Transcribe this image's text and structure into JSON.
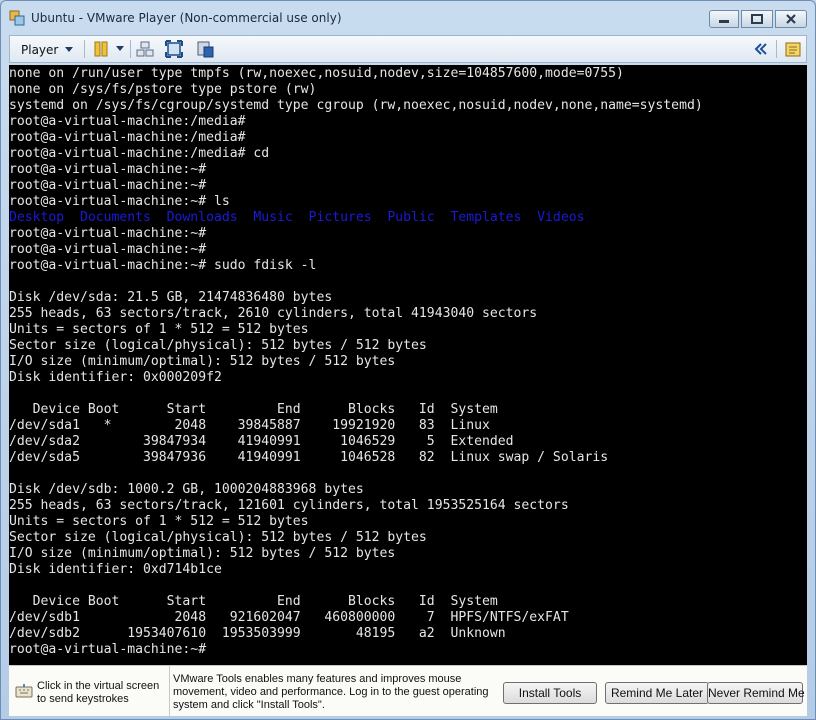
{
  "window": {
    "title": "Ubuntu - VMware Player (Non-commercial use only)"
  },
  "toolbar": {
    "player_label": "Player",
    "icons": [
      "pause-icon",
      "send-keys-icon",
      "fullscreen-icon",
      "unity-icon",
      "collapse-icon",
      "library-icon"
    ]
  },
  "terminal": {
    "lines": [
      "none on /run/user type tmpfs (rw,noexec,nosuid,nodev,size=104857600,mode=0755)",
      "none on /sys/fs/pstore type pstore (rw)",
      "systemd on /sys/fs/cgroup/systemd type cgroup (rw,noexec,nosuid,nodev,none,name=systemd)",
      "root@a-virtual-machine:/media#",
      "root@a-virtual-machine:/media#",
      "root@a-virtual-machine:/media# cd",
      "root@a-virtual-machine:~#",
      "root@a-virtual-machine:~#",
      "root@a-virtual-machine:~# ls",
      "Desktop  Documents  Downloads  Music  Pictures  Public  Templates  Videos",
      "root@a-virtual-machine:~#",
      "root@a-virtual-machine:~#",
      "root@a-virtual-machine:~# sudo fdisk -l",
      "",
      "Disk /dev/sda: 21.5 GB, 21474836480 bytes",
      "255 heads, 63 sectors/track, 2610 cylinders, total 41943040 sectors",
      "Units = sectors of 1 * 512 = 512 bytes",
      "Sector size (logical/physical): 512 bytes / 512 bytes",
      "I/O size (minimum/optimal): 512 bytes / 512 bytes",
      "Disk identifier: 0x000209f2",
      "",
      "   Device Boot      Start         End      Blocks   Id  System",
      "/dev/sda1   *        2048    39845887    19921920   83  Linux",
      "/dev/sda2        39847934    41940991     1046529    5  Extended",
      "/dev/sda5        39847936    41940991     1046528   82  Linux swap / Solaris",
      "",
      "Disk /dev/sdb: 1000.2 GB, 1000204883968 bytes",
      "255 heads, 63 sectors/track, 121601 cylinders, total 1953525164 sectors",
      "Units = sectors of 1 * 512 = 512 bytes",
      "Sector size (logical/physical): 512 bytes / 512 bytes",
      "I/O size (minimum/optimal): 512 bytes / 512 bytes",
      "Disk identifier: 0xd714b1ce",
      "",
      "   Device Boot      Start         End      Blocks   Id  System",
      "/dev/sdb1            2048   921602047   460800000    7  HPFS/NTFS/exFAT",
      "/dev/sdb2      1953407610  1953503999       48195   a2  Unknown",
      "root@a-virtual-machine:~#"
    ],
    "directory_color": "#1a1ad8",
    "text_color": "#e6e6e6"
  },
  "notification": {
    "hint": "Click in the virtual screen to send keystrokes",
    "message": "VMware Tools enables many features and improves mouse movement, video and performance. Log in to the guest operating system and click \"Install Tools\".",
    "buttons": {
      "install": "Install Tools",
      "remind_later": "Remind Me Later",
      "never_remind": "Never Remind Me"
    }
  }
}
